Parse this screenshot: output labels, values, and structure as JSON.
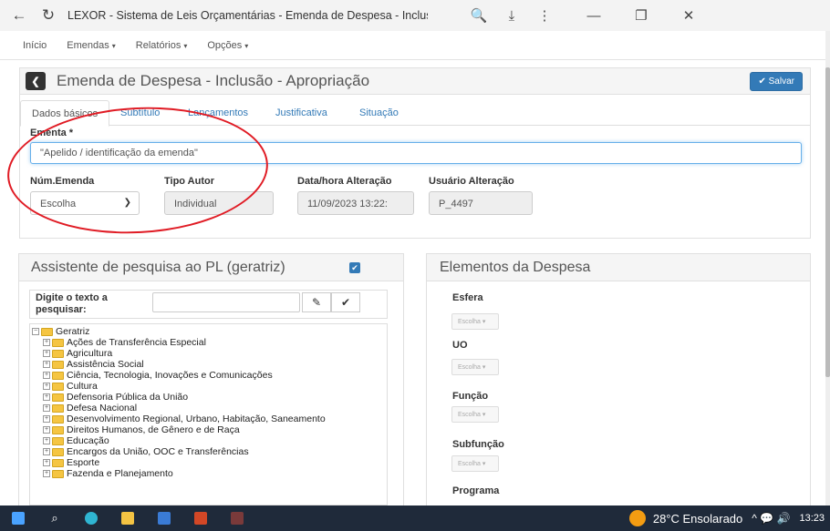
{
  "browser": {
    "title": "LEXOR - Sistema de Leis Orçamentárias - Emenda de Despesa - Inclusão - Apropria...",
    "back_icon": "←",
    "reload_icon": "↻",
    "zoom_icon": "🔍",
    "download_icon": "⤓",
    "more_icon": "⋮",
    "minimize_icon": "—",
    "restore_icon": "❐",
    "close_icon": "✕"
  },
  "menubar": {
    "items": [
      {
        "label": "Início",
        "caret": ""
      },
      {
        "label": "Emendas",
        "caret": "▾"
      },
      {
        "label": "Relatórios",
        "caret": "▾"
      },
      {
        "label": "Opções",
        "caret": "▾"
      }
    ]
  },
  "main_panel": {
    "back_icon": "❮",
    "title": "Emenda de Despesa - Inclusão - Apropriação",
    "save_label": "✔ Salvar",
    "tabs": [
      "Dados básicos",
      "Subtítulo",
      "Lançamentos",
      "Justificativa",
      "Situação"
    ],
    "ementa_label": "Ementa *",
    "ementa_value": "\"Apelido / identificação da emenda\"",
    "num_emenda_label": "Núm.Emenda",
    "num_emenda_value": "Escolha",
    "tipo_autor_label": "Tipo Autor",
    "tipo_autor_value": "Individual",
    "data_alteracao_label": "Data/hora Alteração",
    "data_alteracao_value": "11/09/2023 13:22:",
    "usuario_alteracao_label": "Usuário Alteração",
    "usuario_alteracao_value": "P_4497"
  },
  "assistant_panel": {
    "title": "Assistente de pesquisa ao PL (geratriz)",
    "checkbox_glyph": "✔",
    "search_label": "Digite o texto a pesquisar:",
    "clear_glyph": "✎",
    "confirm_glyph": "✔",
    "tree_root": "Geratriz",
    "tree_items": [
      "Ações de Transferência Especial",
      "Agricultura",
      "Assistência Social",
      "Ciência, Tecnologia, Inovações e Comunicações",
      "Cultura",
      "Defensoria Pública da União",
      "Defesa Nacional",
      "Desenvolvimento Regional, Urbano, Habitação, Saneamento",
      "Direitos Humanos, de Gênero e de Raça",
      "Educação",
      "Encargos da União, OOC e Transferências",
      "Esporte",
      "Fazenda e Planejamento"
    ]
  },
  "elements_panel": {
    "title": "Elementos da Despesa",
    "fields": [
      {
        "label": "Esfera",
        "value": "Escolha ▾"
      },
      {
        "label": "UO",
        "value": "Escolha ▾"
      },
      {
        "label": "Função",
        "value": "Escolha ▾"
      },
      {
        "label": "Subfunção",
        "value": "Escolha ▾"
      },
      {
        "label": "Programa",
        "value": ""
      }
    ]
  },
  "taskbar": {
    "weather": "28°C Ensolarado",
    "tray_icons": "^ 💬 🔊",
    "time": "13:23"
  },
  "colors": {
    "accent": "#337ab7",
    "annotation": "#e01b24",
    "taskbar": "#1f2a3a"
  }
}
